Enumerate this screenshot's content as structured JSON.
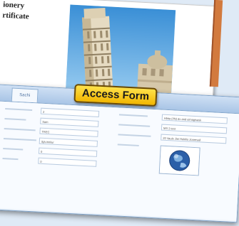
{
  "document": {
    "lines": [
      "ionery",
      "rtificate"
    ]
  },
  "form": {
    "tab_label": "Sachi",
    "left_fields": [
      {
        "label": "",
        "value": "2"
      },
      {
        "label": "",
        "value": "Sam"
      },
      {
        "label": "",
        "value": "TREC"
      },
      {
        "label": "",
        "value": "Sjá-innilur"
      },
      {
        "label": "",
        "value": "0"
      },
      {
        "label": "",
        "value": "0"
      }
    ],
    "right_fields": [
      {
        "label": "",
        "value": "Hlata (I/N) dx and uimagisask"
      },
      {
        "label": "",
        "value": "MS 2 test"
      },
      {
        "label": "",
        "value": "20 Vaulo Jiei Holnlio Joaresali"
      }
    ]
  },
  "badge": {
    "label": "Access Form",
    "color": "#f5c400"
  },
  "icons": [
    "leaning-tower-photo",
    "globe-photo"
  ]
}
